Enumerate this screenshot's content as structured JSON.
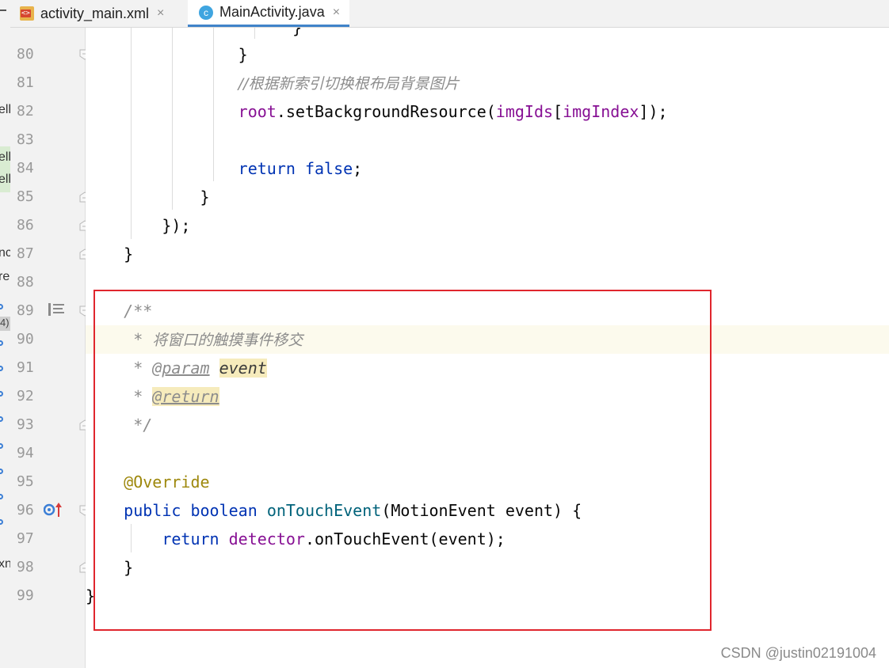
{
  "tabs": [
    {
      "label": "activity_main.xml",
      "icon": "xml-file-icon",
      "active": false
    },
    {
      "label": "MainActivity.java",
      "icon": "java-class-icon",
      "active": true
    }
  ],
  "close_glyph": "×",
  "left_panel_fragments": [
    "ell",
    "ell",
    "ell",
    "nc",
    "re",
    "4)",
    "xn"
  ],
  "line_numbers": [
    "80",
    "81",
    "82",
    "83",
    "84",
    "85",
    "86",
    "87",
    "88",
    "89",
    "90",
    "91",
    "92",
    "93",
    "94",
    "95",
    "96",
    "97",
    "98",
    "99"
  ],
  "code": {
    "l80": {
      "brace": "}"
    },
    "l81": {
      "comment": "//根据新索引切换根布局背景图片"
    },
    "l82": {
      "obj": "root",
      "dot": ".",
      "method": "setBackgroundResource(",
      "arr": "imgIds",
      "lb": "[",
      "idx": "imgIndex",
      "end": "]);"
    },
    "l84": {
      "kw": "return",
      "val": "false",
      "semi": ";"
    },
    "l85": {
      "brace": "}"
    },
    "l86": {
      "text": "});"
    },
    "l87": {
      "brace": "}"
    },
    "l89": {
      "text": "/**"
    },
    "l90": {
      "star": " * ",
      "text": "将窗口的触摸事件移交"
    },
    "l91": {
      "star": " * ",
      "tag": "@param",
      "param": "event"
    },
    "l92": {
      "star": " * ",
      "tag": "@return"
    },
    "l93": {
      "text": " */"
    },
    "l95": {
      "annotation": "@Override"
    },
    "l96": {
      "kw1": "public",
      "kw2": "boolean",
      "name": "onTouchEvent",
      "sig": "(MotionEvent event) {"
    },
    "l97": {
      "kw": "return",
      "field": "detector",
      "call": ".onTouchEvent(event);"
    },
    "l98": {
      "brace": "}"
    },
    "l99": {
      "brace": "}"
    }
  },
  "watermark": "CSDN @justin02191004",
  "colors": {
    "keyword": "#0033b3",
    "field": "#871094",
    "method_decl": "#00627a",
    "annotation": "#9e880d",
    "comment": "#8c8c8c",
    "highlight_box": "#e0262d",
    "active_tab_underline": "#4083c9"
  }
}
